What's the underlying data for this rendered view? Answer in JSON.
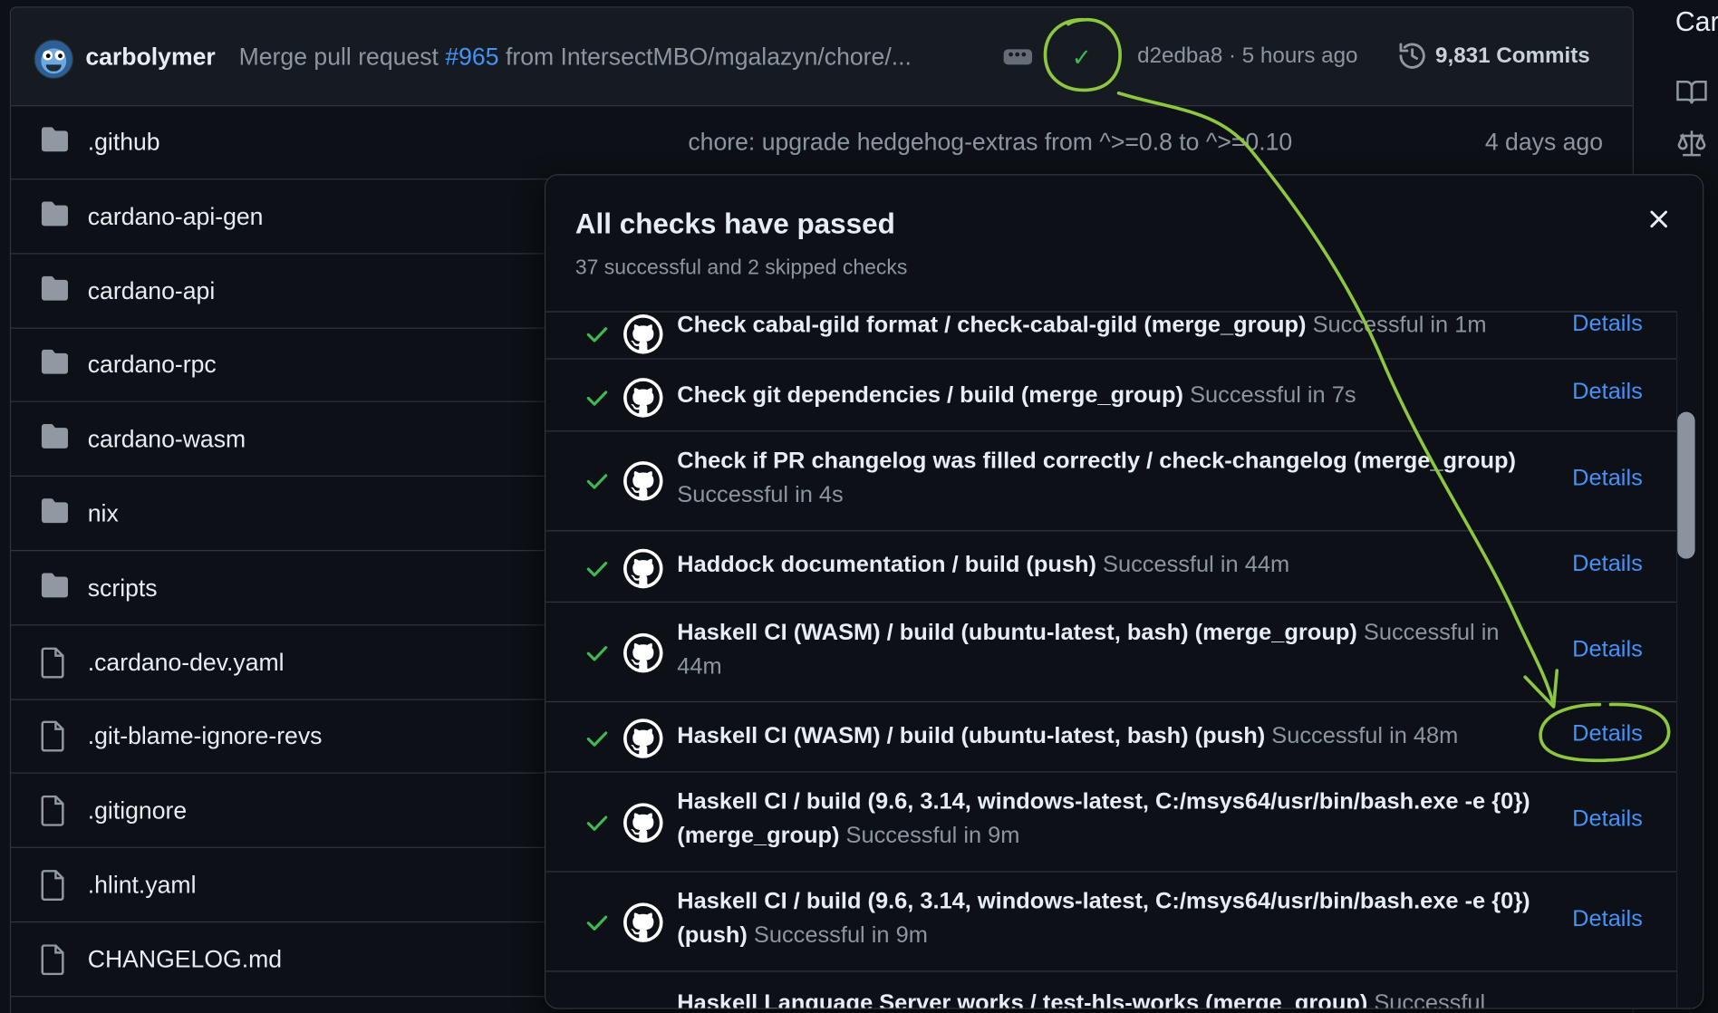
{
  "commit_bar": {
    "author": "carbolymer",
    "message_prefix": "Merge pull request",
    "pr_number": "#965",
    "message_suffix": "from IntersectMBO/mgalazyn/chore/...",
    "ellipsis": "•••",
    "status": "✓",
    "sha_time": "d2edba8 · 5 hours ago",
    "commits": "9,831 Commits"
  },
  "files": [
    {
      "name": ".github",
      "type": "folder",
      "message": "chore: upgrade hedgehog-extras from ^>=0.8 to ^>=0.10",
      "date": "4 days ago"
    },
    {
      "name": "cardano-api-gen",
      "type": "folder"
    },
    {
      "name": "cardano-api",
      "type": "folder"
    },
    {
      "name": "cardano-rpc",
      "type": "folder"
    },
    {
      "name": "cardano-wasm",
      "type": "folder"
    },
    {
      "name": "nix",
      "type": "folder"
    },
    {
      "name": "scripts",
      "type": "folder"
    },
    {
      "name": ".cardano-dev.yaml",
      "type": "file"
    },
    {
      "name": ".git-blame-ignore-revs",
      "type": "file"
    },
    {
      "name": ".gitignore",
      "type": "file"
    },
    {
      "name": ".hlint.yaml",
      "type": "file"
    },
    {
      "name": "CHANGELOG.md",
      "type": "file"
    }
  ],
  "side": {
    "partial_title": "Car"
  },
  "popover": {
    "title": "All checks have passed",
    "subtitle": "37 successful and 2 skipped checks",
    "details_label": "Details",
    "checks": [
      {
        "name": "Check cabal-gild format / check-cabal-gild (merge_group)",
        "status": "Successful in 1m"
      },
      {
        "name": "Check git dependencies / build (merge_group)",
        "status": "Successful in 7s"
      },
      {
        "name": "Check if PR changelog was filled correctly / check-changelog (merge_group)",
        "status": "Successful in 4s"
      },
      {
        "name": "Haddock documentation / build (push)",
        "status": "Successful in 44m"
      },
      {
        "name": "Haskell CI (WASM) / build (ubuntu-latest, bash) (merge_group)",
        "status": "Successful in 44m"
      },
      {
        "name": "Haskell CI (WASM) / build (ubuntu-latest, bash) (push)",
        "status": "Successful in 48m"
      },
      {
        "name": "Haskell CI / build (9.6, 3.14, windows-latest, C:/msys64/usr/bin/bash.exe -e {0}) (merge_group)",
        "status": "Successful in 9m"
      },
      {
        "name": "Haskell CI / build (9.6, 3.14, windows-latest, C:/msys64/usr/bin/bash.exe -e {0}) (push)",
        "status": "Successful in 9m"
      },
      {
        "name": "Haskell Language Server works / test-hls-works (merge_group)",
        "status": "Successful"
      }
    ]
  },
  "colors": {
    "background": "#0d1117",
    "header": "#161b22",
    "border": "#30363d",
    "text": "#e6edf3",
    "muted": "#8d96a0",
    "link": "#4493f8",
    "success": "#3fb950",
    "annotation": "#8dc63f"
  }
}
